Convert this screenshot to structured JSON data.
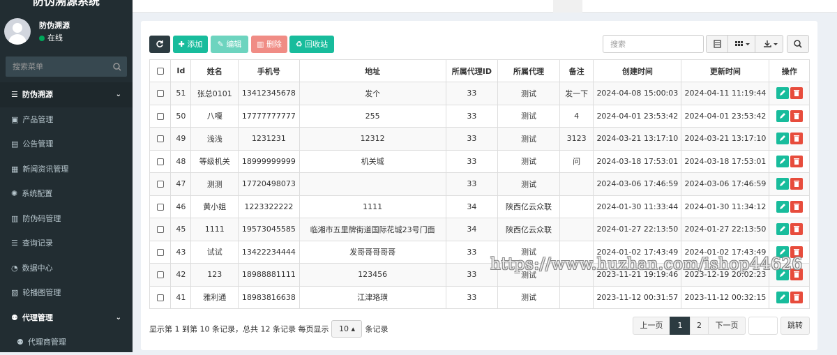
{
  "sidebar": {
    "brand": "防伪溯源系统",
    "user_name": "防伪溯源",
    "user_status": "在线",
    "search_placeholder": "搜索菜单",
    "menu": [
      {
        "label": "防伪溯源",
        "type": "head",
        "icon": "list-icon",
        "chevron": "⌄"
      },
      {
        "label": "产品管理",
        "type": "item",
        "icon": "shopping-bag-icon"
      },
      {
        "label": "公告管理",
        "type": "item",
        "icon": "file-icon"
      },
      {
        "label": "新闻资讯管理",
        "type": "item",
        "icon": "newspaper-icon"
      },
      {
        "label": "系统配置",
        "type": "item",
        "icon": "gear-icon"
      },
      {
        "label": "防伪码管理",
        "type": "item",
        "icon": "barcode-icon"
      },
      {
        "label": "查询记录",
        "type": "item",
        "icon": "list-icon"
      },
      {
        "label": "数据中心",
        "type": "item",
        "icon": "dashboard-icon"
      },
      {
        "label": "轮播图管理",
        "type": "item",
        "icon": "image-icon"
      },
      {
        "label": "代理管理",
        "type": "head2",
        "icon": "users-icon",
        "chevron": "⌄"
      },
      {
        "label": "代理商管理",
        "type": "sub",
        "icon": "users-icon"
      }
    ]
  },
  "toolbar": {
    "add": "添加",
    "edit": "编辑",
    "delete": "删除",
    "recycle": "回收站",
    "search_placeholder": "搜索"
  },
  "table": {
    "headers": [
      "Id",
      "姓名",
      "手机号",
      "地址",
      "所属代理ID",
      "所属代理",
      "备注",
      "创建时间",
      "更新时间",
      "操作"
    ],
    "rows": [
      [
        "51",
        "张总0101",
        "13412345678",
        "发个",
        "33",
        "测试",
        "发一下",
        "2024-04-08 15:00:03",
        "2024-04-11 11:19:44"
      ],
      [
        "50",
        "八嘎",
        "17777777777",
        "255",
        "33",
        "测试",
        "4",
        "2024-04-01 23:53:42",
        "2024-04-01 23:53:42"
      ],
      [
        "49",
        "浅浅",
        "1231231",
        "12312",
        "33",
        "测试",
        "3123",
        "2024-03-21 13:17:10",
        "2024-03-21 13:17:10"
      ],
      [
        "48",
        "等级机关",
        "18999999999",
        "机关城",
        "33",
        "测试",
        "问",
        "2024-03-18 17:53:01",
        "2024-03-18 17:53:01"
      ],
      [
        "47",
        "测测",
        "17720498073",
        "",
        "33",
        "测试",
        "",
        "2024-03-06 17:46:59",
        "2024-03-06 17:46:59"
      ],
      [
        "46",
        "黄小姐",
        "1223322222",
        "1111",
        "34",
        "陕西亿云众联",
        "",
        "2024-01-30 11:33:44",
        "2024-01-30 11:34:12"
      ],
      [
        "45",
        "1111",
        "19573045585",
        "临湘市五里牌街道国际花城23号门面",
        "34",
        "陕西亿云众联",
        "",
        "2024-01-27 22:13:50",
        "2024-01-27 22:13:50"
      ],
      [
        "43",
        "试试",
        "13422234444",
        "发哥哥哥哥哥",
        "33",
        "测试",
        "",
        "2024-01-02 17:43:49",
        "2024-01-02 17:43:49"
      ],
      [
        "42",
        "123",
        "18988881111",
        "123456",
        "33",
        "测试",
        "",
        "2023-11-21 19:19:46",
        "2023-12-19 20:02:23"
      ],
      [
        "41",
        "雅利通",
        "18983816638",
        "江津珞璜",
        "33",
        "测试",
        "",
        "2023-11-12 00:31:57",
        "2023-11-12 00:32:15"
      ]
    ]
  },
  "footer": {
    "info_prefix": "显示第 1 到第 10 条记录，总共 12 条记录 每页显示",
    "page_size": "10",
    "info_suffix": "条记录",
    "prev": "上一页",
    "page1": "1",
    "page2": "2",
    "next": "下一页",
    "go": "跳转"
  },
  "watermark": "https://www.huzhan.com/ishop44626",
  "colors": {
    "sidebar_bg": "#222d32",
    "primary": "#18bc9c",
    "danger": "#e74c3c",
    "dark": "#2c3b41"
  }
}
